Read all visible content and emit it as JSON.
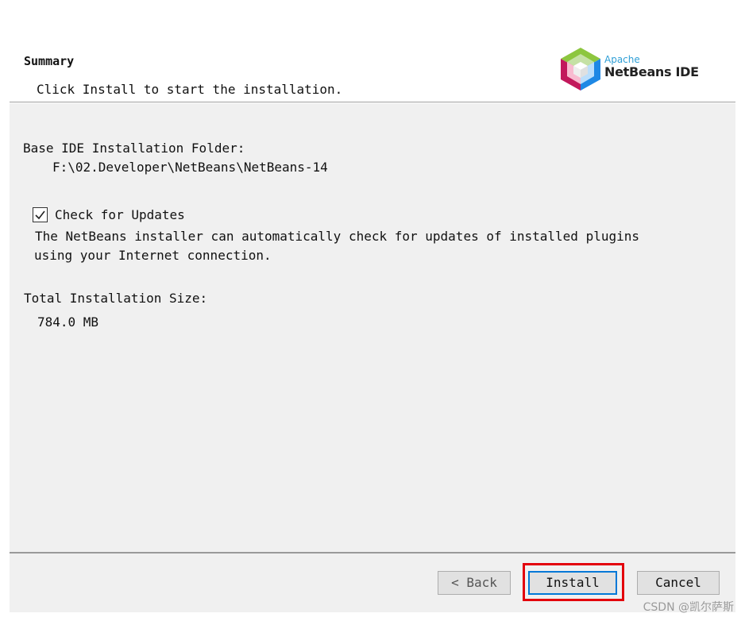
{
  "header": {
    "title": "Summary",
    "subtitle": "Click Install to start the installation.",
    "logo": {
      "apache_label": "Apache",
      "product_label": "NetBeans IDE"
    }
  },
  "content": {
    "folder_label": "Base IDE Installation Folder:",
    "folder_path": "F:\\02.Developer\\NetBeans\\NetBeans-14",
    "check_updates": {
      "label": "Check for Updates",
      "checked": true,
      "description_line1": "The NetBeans installer can automatically check for updates of installed plugins",
      "description_line2": "using your Internet connection."
    },
    "size_label": "Total Installation Size:",
    "size_value": "784.0 MB"
  },
  "footer": {
    "back_label": "< Back",
    "install_label": "Install",
    "cancel_label": "Cancel"
  },
  "watermark": "CSDN @凯尔萨斯",
  "colors": {
    "content_bg": "#f0f0f0",
    "highlight_border": "#e3000b",
    "focus_border": "#0078d7"
  }
}
